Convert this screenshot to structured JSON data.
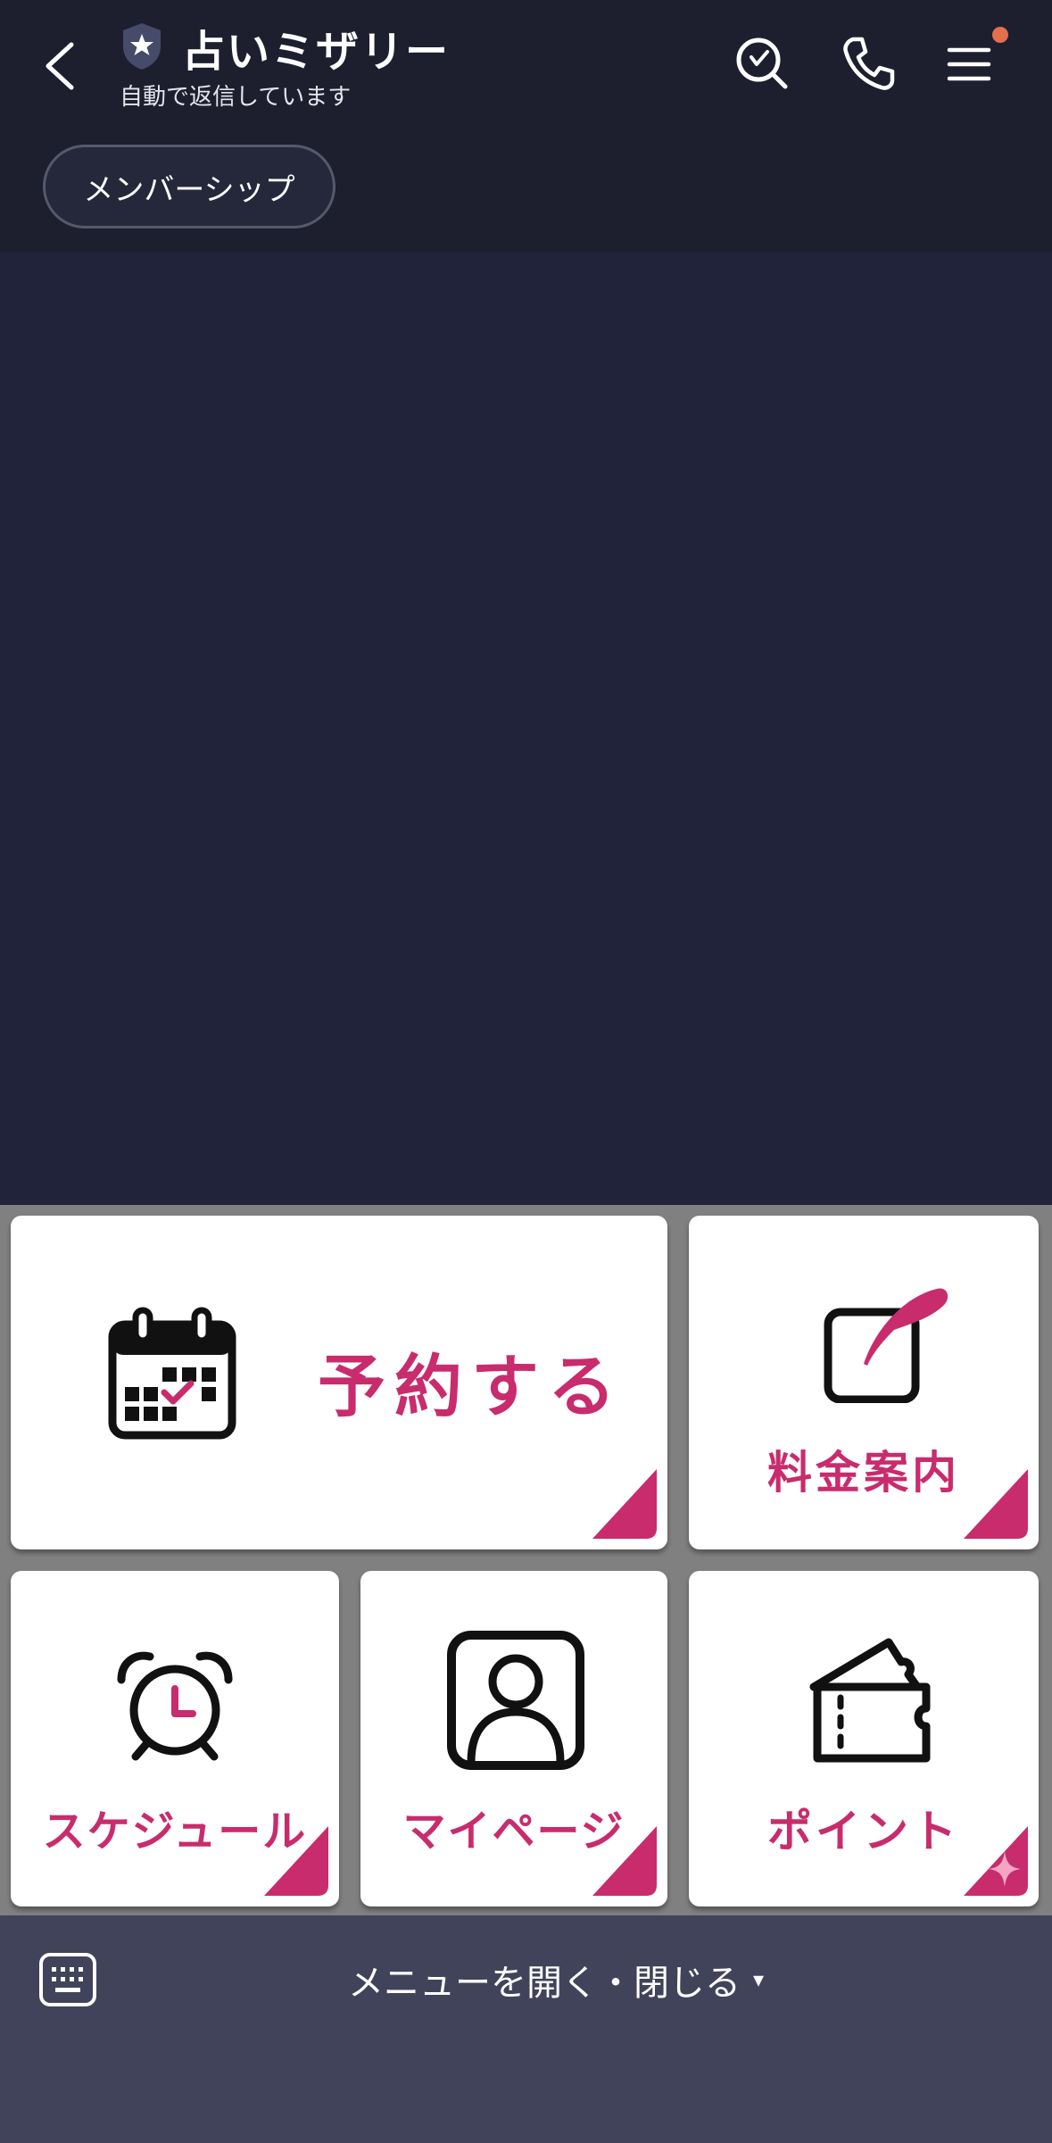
{
  "header": {
    "title": "占いミザリー",
    "subtitle": "自動で返信しています",
    "membership_chip": "メンバーシップ"
  },
  "colors": {
    "accent": "#c82c6c",
    "header_bg": "#1d1f2f",
    "chat_bg": "#20233a",
    "bottom_bar_bg": "#41435a",
    "notify_dot": "#e56e4d"
  },
  "icons": {
    "back": "chevron-left-icon",
    "badge": "shield-star-icon",
    "search": "search-icon",
    "call": "phone-icon",
    "menu": "hamburger-icon",
    "keyboard": "keyboard-icon"
  },
  "rich_menu": {
    "tiles": [
      {
        "label": "予約する",
        "icon": "calendar-icon"
      },
      {
        "label": "料金案内",
        "icon": "pen-note-icon"
      },
      {
        "label": "スケジュール",
        "icon": "alarm-clock-icon"
      },
      {
        "label": "マイページ",
        "icon": "user-profile-icon"
      },
      {
        "label": "ポイント",
        "icon": "ticket-icon"
      }
    ]
  },
  "bottom_bar": {
    "menu_toggle": "メニューを開く・閉じる",
    "caret": "▾"
  }
}
